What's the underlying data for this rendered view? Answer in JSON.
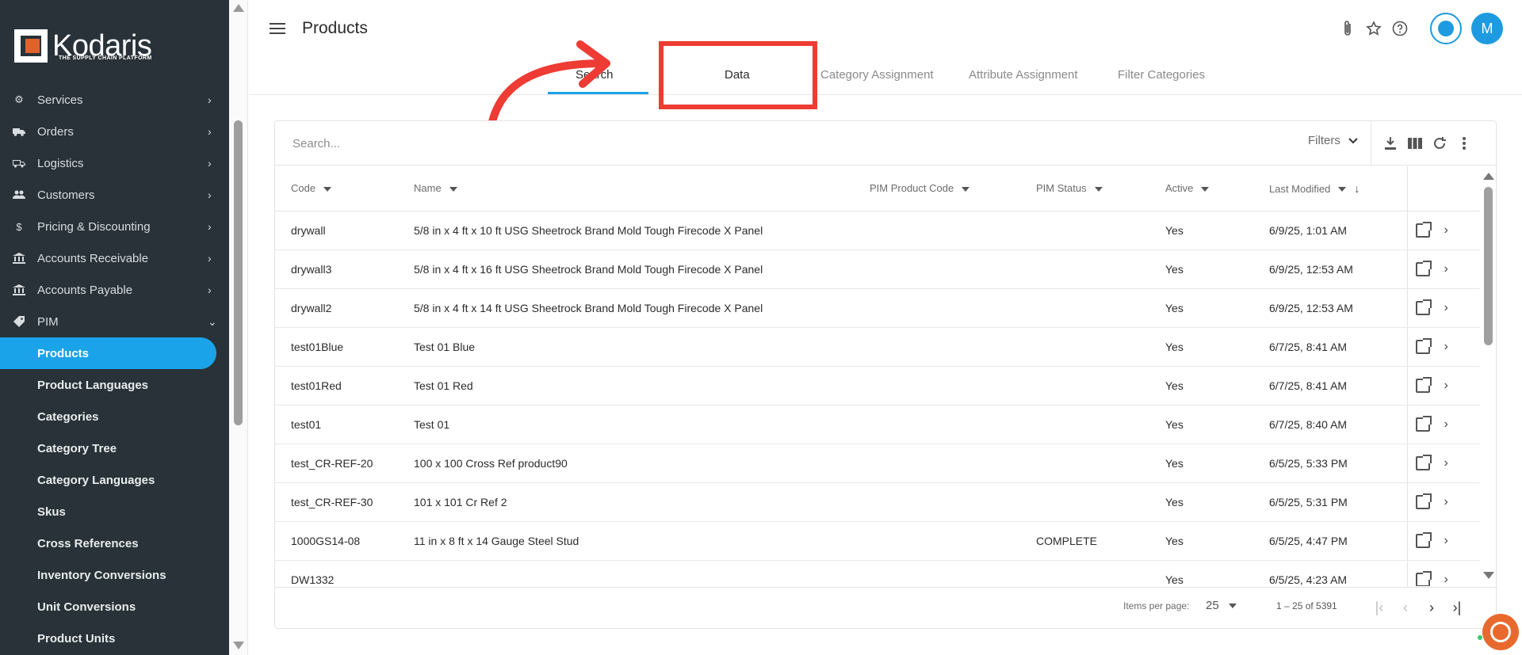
{
  "app": {
    "logo_text": "Kodaris",
    "logo_tagline": "THE SUPPLY CHAIN PLATFORM"
  },
  "sidebar": {
    "items": [
      {
        "label": "Services",
        "icon": "gears-icon"
      },
      {
        "label": "Orders",
        "icon": "truck-icon"
      },
      {
        "label": "Logistics",
        "icon": "delivery-truck-icon"
      },
      {
        "label": "Customers",
        "icon": "people-icon"
      },
      {
        "label": "Pricing & Discounting",
        "icon": "dollar-icon"
      },
      {
        "label": "Accounts Receivable",
        "icon": "bank-icon"
      },
      {
        "label": "Accounts Payable",
        "icon": "bank-icon"
      },
      {
        "label": "PIM",
        "icon": "tag-icon"
      }
    ],
    "pim_children": [
      {
        "label": "Products",
        "active": true
      },
      {
        "label": "Product Languages"
      },
      {
        "label": "Categories"
      },
      {
        "label": "Category Tree"
      },
      {
        "label": "Category Languages"
      },
      {
        "label": "Skus"
      },
      {
        "label": "Cross References"
      },
      {
        "label": "Inventory Conversions"
      },
      {
        "label": "Unit Conversions"
      },
      {
        "label": "Product Units"
      }
    ]
  },
  "header": {
    "title": "Products",
    "avatar_initial": "M",
    "tabs": [
      {
        "label": "Search",
        "active": true
      },
      {
        "label": "Data"
      },
      {
        "label": "Category Assignment"
      },
      {
        "label": "Attribute Assignment"
      },
      {
        "label": "Filter Categories"
      }
    ]
  },
  "toolbar": {
    "search_placeholder": "Search...",
    "filters_label": "Filters"
  },
  "table": {
    "columns": [
      "Code",
      "Name",
      "PIM Product Code",
      "PIM Status",
      "Active",
      "Last Modified"
    ],
    "rows": [
      {
        "code": "drywall",
        "name": "5/8 in x 4 ft x 10 ft USG Sheetrock Brand Mold Tough Firecode X Panel",
        "pim_code": "",
        "pim_status": "",
        "active": "Yes",
        "modified": "6/9/25, 1:01 AM"
      },
      {
        "code": "drywall3",
        "name": "5/8 in x 4 ft x 16 ft USG Sheetrock Brand Mold Tough Firecode X Panel",
        "pim_code": "",
        "pim_status": "",
        "active": "Yes",
        "modified": "6/9/25, 12:53 AM"
      },
      {
        "code": "drywall2",
        "name": "5/8 in x 4 ft x 14 ft USG Sheetrock Brand Mold Tough Firecode X Panel",
        "pim_code": "",
        "pim_status": "",
        "active": "Yes",
        "modified": "6/9/25, 12:53 AM"
      },
      {
        "code": "test01Blue",
        "name": "Test 01 Blue",
        "pim_code": "",
        "pim_status": "",
        "active": "Yes",
        "modified": "6/7/25, 8:41 AM"
      },
      {
        "code": "test01Red",
        "name": "Test 01 Red",
        "pim_code": "",
        "pim_status": "",
        "active": "Yes",
        "modified": "6/7/25, 8:41 AM"
      },
      {
        "code": "test01",
        "name": "Test 01",
        "pim_code": "",
        "pim_status": "",
        "active": "Yes",
        "modified": "6/7/25, 8:40 AM"
      },
      {
        "code": "test_CR-REF-20",
        "name": "100 x 100 Cross Ref product90",
        "pim_code": "",
        "pim_status": "",
        "active": "Yes",
        "modified": "6/5/25, 5:33 PM"
      },
      {
        "code": "test_CR-REF-30",
        "name": "101 x 101 Cr Ref 2",
        "pim_code": "",
        "pim_status": "",
        "active": "Yes",
        "modified": "6/5/25, 5:31 PM"
      },
      {
        "code": "1000GS14-08",
        "name": "11 in x 8 ft x 14 Gauge Steel Stud",
        "pim_code": "",
        "pim_status": "COMPLETE",
        "active": "Yes",
        "modified": "6/5/25, 4:47 PM"
      },
      {
        "code": "DW1332",
        "name": "",
        "pim_code": "",
        "pim_status": "",
        "active": "Yes",
        "modified": "6/5/25, 4:23 AM"
      }
    ]
  },
  "paginator": {
    "items_per_page_label": "Items per page:",
    "page_size": "25",
    "range_label": "1 – 25 of 5391"
  },
  "colors": {
    "sidebar_bg": "#283238",
    "accent": "#1aa3e8",
    "annotation_red": "#ee3b33",
    "brand_orange": "#e2622b"
  }
}
